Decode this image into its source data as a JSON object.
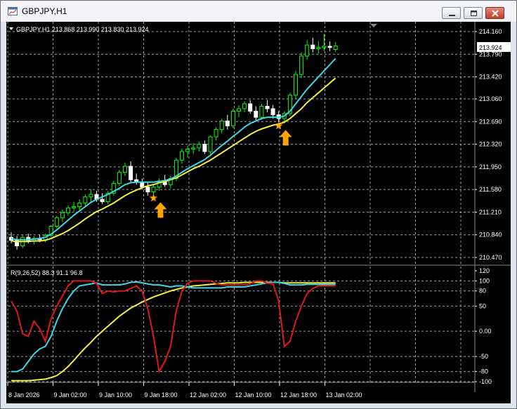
{
  "window": {
    "title": "GBPJPY,H1",
    "minimize_label": "minimize",
    "maximize_label": "maximize",
    "close_label": "close"
  },
  "colors": {
    "background": "#000000",
    "grid": "#9aa2aa",
    "bull_candle": "#00ff00",
    "bear_candle": "#ffffff",
    "ma_fast": "#40d8e8",
    "ma_slow": "#f5f03c",
    "osc_red": "#e01818",
    "osc_cyan": "#40d8e8",
    "osc_yellow": "#f5f03c",
    "signal": "#ffa500",
    "text": "#ffffff"
  },
  "price_panel": {
    "header": "GBPJPY,H1  213.868 213.990 213.830 213.924",
    "current_price": "213.924",
    "price_axis": [
      "214.160",
      "213.790",
      "213.420",
      "213.060",
      "212.690",
      "212.320",
      "211.950",
      "211.580",
      "211.210",
      "210.840",
      "210.470"
    ]
  },
  "oscillator_panel": {
    "header": "R(9,26,52) 88.3 91.1 96.8",
    "axis": [
      "120",
      "100",
      "80",
      "50",
      "0.00",
      "-50",
      "-80",
      "-100"
    ]
  },
  "time_axis": [
    "8 Jan 2026",
    "9 Jan 02:00",
    "9 Jan 10:00",
    "9 Jan 18:00",
    "12 Jan 02:00",
    "12 Jan 10:00",
    "12 Jan 18:00",
    "13 Jan 02:00"
  ],
  "chart_data": {
    "type": "candlestick",
    "symbol": "GBPJPY",
    "timeframe": "H1",
    "price_range": [
      210.47,
      214.16
    ],
    "oscillator_range": [
      -100,
      120
    ],
    "candles": [
      {
        "o": 210.8,
        "h": 210.88,
        "l": 210.7,
        "c": 210.75
      },
      {
        "o": 210.75,
        "h": 210.82,
        "l": 210.6,
        "c": 210.66
      },
      {
        "o": 210.66,
        "h": 210.85,
        "l": 210.62,
        "c": 210.8
      },
      {
        "o": 210.8,
        "h": 210.86,
        "l": 210.7,
        "c": 210.74
      },
      {
        "o": 210.74,
        "h": 210.82,
        "l": 210.68,
        "c": 210.78
      },
      {
        "o": 210.78,
        "h": 210.84,
        "l": 210.72,
        "c": 210.76
      },
      {
        "o": 210.76,
        "h": 210.86,
        "l": 210.72,
        "c": 210.83
      },
      {
        "o": 210.83,
        "h": 211.0,
        "l": 210.8,
        "c": 210.98
      },
      {
        "o": 210.98,
        "h": 211.15,
        "l": 210.95,
        "c": 211.12
      },
      {
        "o": 211.12,
        "h": 211.25,
        "l": 211.05,
        "c": 211.2
      },
      {
        "o": 211.2,
        "h": 211.32,
        "l": 211.15,
        "c": 211.28
      },
      {
        "o": 211.28,
        "h": 211.38,
        "l": 211.22,
        "c": 211.3
      },
      {
        "o": 211.3,
        "h": 211.42,
        "l": 211.24,
        "c": 211.36
      },
      {
        "o": 211.36,
        "h": 211.5,
        "l": 211.3,
        "c": 211.46
      },
      {
        "o": 211.46,
        "h": 211.58,
        "l": 211.38,
        "c": 211.5
      },
      {
        "o": 211.5,
        "h": 211.56,
        "l": 211.38,
        "c": 211.42
      },
      {
        "o": 211.42,
        "h": 211.52,
        "l": 211.34,
        "c": 211.38
      },
      {
        "o": 211.38,
        "h": 211.56,
        "l": 211.34,
        "c": 211.52
      },
      {
        "o": 211.52,
        "h": 211.72,
        "l": 211.48,
        "c": 211.68
      },
      {
        "o": 211.68,
        "h": 211.9,
        "l": 211.64,
        "c": 211.86
      },
      {
        "o": 211.86,
        "h": 212.02,
        "l": 211.8,
        "c": 211.96
      },
      {
        "o": 211.96,
        "h": 212.04,
        "l": 211.7,
        "c": 211.74
      },
      {
        "o": 211.74,
        "h": 211.84,
        "l": 211.66,
        "c": 211.7
      },
      {
        "o": 211.7,
        "h": 211.76,
        "l": 211.58,
        "c": 211.62
      },
      {
        "o": 211.62,
        "h": 211.7,
        "l": 211.48,
        "c": 211.54
      },
      {
        "o": 211.54,
        "h": 211.66,
        "l": 211.5,
        "c": 211.62
      },
      {
        "o": 211.62,
        "h": 211.76,
        "l": 211.56,
        "c": 211.72
      },
      {
        "o": 211.72,
        "h": 211.82,
        "l": 211.62,
        "c": 211.66
      },
      {
        "o": 211.66,
        "h": 211.8,
        "l": 211.6,
        "c": 211.76
      },
      {
        "o": 211.76,
        "h": 212.1,
        "l": 211.72,
        "c": 212.06
      },
      {
        "o": 212.06,
        "h": 212.25,
        "l": 212.0,
        "c": 212.2
      },
      {
        "o": 212.2,
        "h": 212.3,
        "l": 212.1,
        "c": 212.24
      },
      {
        "o": 212.24,
        "h": 212.34,
        "l": 212.16,
        "c": 212.26
      },
      {
        "o": 212.26,
        "h": 212.36,
        "l": 212.2,
        "c": 212.32
      },
      {
        "o": 212.32,
        "h": 212.38,
        "l": 212.16,
        "c": 212.2
      },
      {
        "o": 212.2,
        "h": 212.46,
        "l": 212.16,
        "c": 212.44
      },
      {
        "o": 212.44,
        "h": 212.6,
        "l": 212.38,
        "c": 212.56
      },
      {
        "o": 212.56,
        "h": 212.74,
        "l": 212.5,
        "c": 212.7
      },
      {
        "o": 212.7,
        "h": 212.8,
        "l": 212.56,
        "c": 212.62
      },
      {
        "o": 212.62,
        "h": 212.9,
        "l": 212.58,
        "c": 212.86
      },
      {
        "o": 212.86,
        "h": 212.96,
        "l": 212.76,
        "c": 212.9
      },
      {
        "o": 212.9,
        "h": 213.02,
        "l": 212.84,
        "c": 212.98
      },
      {
        "o": 212.98,
        "h": 213.04,
        "l": 212.82,
        "c": 212.86
      },
      {
        "o": 212.86,
        "h": 212.94,
        "l": 212.7,
        "c": 212.76
      },
      {
        "o": 212.76,
        "h": 212.98,
        "l": 212.72,
        "c": 212.94
      },
      {
        "o": 212.94,
        "h": 213.04,
        "l": 212.84,
        "c": 212.9
      },
      {
        "o": 212.9,
        "h": 212.96,
        "l": 212.74,
        "c": 212.8
      },
      {
        "o": 212.8,
        "h": 212.86,
        "l": 212.68,
        "c": 212.74
      },
      {
        "o": 212.74,
        "h": 212.86,
        "l": 212.66,
        "c": 212.82
      },
      {
        "o": 212.82,
        "h": 213.16,
        "l": 212.78,
        "c": 213.12
      },
      {
        "o": 213.12,
        "h": 213.52,
        "l": 213.06,
        "c": 213.46
      },
      {
        "o": 213.46,
        "h": 213.82,
        "l": 213.4,
        "c": 213.76
      },
      {
        "o": 213.76,
        "h": 214.02,
        "l": 213.7,
        "c": 213.94
      },
      {
        "o": 213.94,
        "h": 214.06,
        "l": 213.82,
        "c": 213.88
      },
      {
        "o": 213.88,
        "h": 214.0,
        "l": 213.8,
        "c": 213.9
      },
      {
        "o": 213.9,
        "h": 214.12,
        "l": 213.84,
        "c": 213.92
      },
      {
        "o": 213.92,
        "h": 214.0,
        "l": 213.84,
        "c": 213.9
      },
      {
        "o": 213.868,
        "h": 213.99,
        "l": 213.83,
        "c": 213.924
      }
    ],
    "ma_fast": [
      210.78,
      210.76,
      210.76,
      210.76,
      210.77,
      210.78,
      210.8,
      210.85,
      210.92,
      211.0,
      211.08,
      211.16,
      211.23,
      211.3,
      211.37,
      211.42,
      211.46,
      211.5,
      211.55,
      211.6,
      211.66,
      211.69,
      211.7,
      211.7,
      211.7,
      211.7,
      211.71,
      211.73,
      211.75,
      211.8,
      211.86,
      211.92,
      211.97,
      212.02,
      212.07,
      212.14,
      212.22,
      212.3,
      212.37,
      212.45,
      212.52,
      212.6,
      212.66,
      212.7,
      212.74,
      212.76,
      212.76,
      212.76,
      212.78,
      212.86,
      212.98,
      213.1,
      213.22,
      213.32,
      213.42,
      213.52,
      213.62,
      213.72
    ],
    "ma_slow": [
      210.74,
      210.73,
      210.73,
      210.73,
      210.74,
      210.74,
      210.75,
      210.78,
      210.82,
      210.86,
      210.91,
      210.97,
      211.03,
      211.1,
      211.16,
      211.22,
      211.26,
      211.31,
      211.36,
      211.42,
      211.48,
      211.53,
      211.57,
      211.61,
      211.64,
      211.66,
      211.69,
      211.71,
      211.74,
      211.77,
      211.82,
      211.87,
      211.92,
      211.96,
      212.01,
      212.06,
      212.12,
      212.18,
      212.24,
      212.3,
      212.36,
      212.42,
      212.48,
      212.53,
      212.57,
      212.6,
      212.63,
      212.65,
      212.68,
      212.74,
      212.82,
      212.9,
      213.0,
      213.08,
      213.16,
      213.24,
      213.32,
      213.4
    ],
    "osc_red": [
      60,
      40,
      -5,
      -10,
      20,
      5,
      -20,
      25,
      50,
      70,
      90,
      100,
      100,
      100,
      100,
      95,
      75,
      80,
      78,
      80,
      80,
      85,
      90,
      80,
      45,
      -10,
      -80,
      -60,
      -30,
      40,
      80,
      95,
      100,
      100,
      100,
      100,
      95,
      92,
      92,
      92,
      92,
      92,
      94,
      100,
      100,
      95,
      95,
      60,
      -30,
      -20,
      20,
      50,
      75,
      85,
      90,
      90,
      90,
      90
    ],
    "osc_cyan": [
      -80,
      -80,
      -75,
      -60,
      -45,
      -35,
      -30,
      -10,
      20,
      45,
      65,
      80,
      90,
      92,
      94,
      96,
      92,
      92,
      92,
      92,
      94,
      97,
      98,
      96,
      94,
      92,
      92,
      90,
      88,
      90,
      90,
      88,
      86,
      86,
      86,
      86,
      86,
      86,
      88,
      88,
      88,
      88,
      90,
      92,
      94,
      96,
      97,
      97,
      95,
      92,
      92,
      92,
      93,
      93,
      93,
      93,
      93,
      93
    ],
    "osc_yellow": [
      -98,
      -98,
      -98,
      -98,
      -97,
      -96,
      -95,
      -92,
      -88,
      -80,
      -70,
      -58,
      -45,
      -33,
      -22,
      -10,
      0,
      10,
      20,
      30,
      38,
      46,
      52,
      58,
      63,
      68,
      72,
      76,
      80,
      83,
      86,
      88,
      90,
      91,
      92,
      93,
      94,
      95,
      96,
      96,
      96,
      97,
      97,
      97,
      97,
      97,
      97,
      97,
      96,
      96,
      96,
      96,
      96,
      96,
      96,
      96,
      96,
      96
    ],
    "signals": [
      {
        "index": 25,
        "price": 211.44,
        "direction": "buy"
      },
      {
        "index": 47,
        "price": 212.62,
        "direction": "buy"
      }
    ]
  }
}
